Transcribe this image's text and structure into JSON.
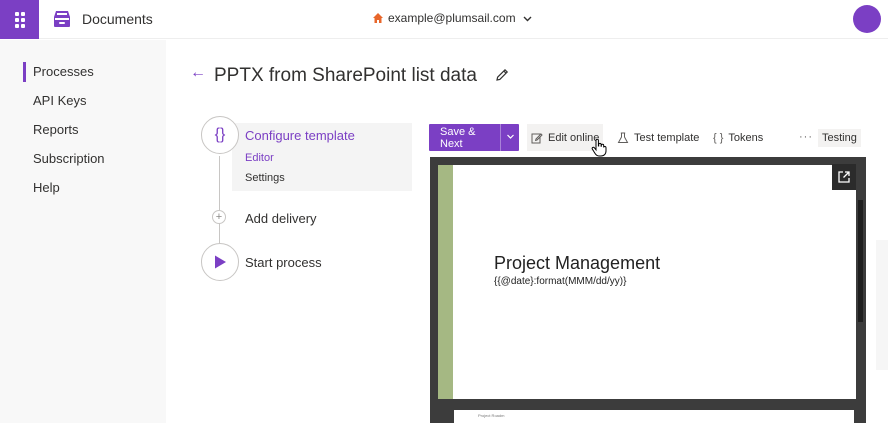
{
  "header": {
    "app_name": "Documents",
    "account_email": "example@plumsail.com"
  },
  "sidebar": {
    "items": [
      {
        "label": "Processes",
        "active": true
      },
      {
        "label": "API Keys"
      },
      {
        "label": "Reports"
      },
      {
        "label": "Subscription"
      },
      {
        "label": "Help"
      }
    ]
  },
  "page": {
    "title": "PPTX from SharePoint list data"
  },
  "steps": {
    "configure": {
      "label": "Configure template",
      "icon": "{}",
      "sub": [
        "Editor",
        "Settings"
      ]
    },
    "delivery": {
      "label": "Add delivery",
      "icon": "+"
    },
    "start": {
      "label": "Start process"
    }
  },
  "toolbar": {
    "save_next": "Save & Next",
    "edit_online": "Edit online",
    "test_template": "Test template",
    "tokens": "Tokens",
    "more": "···",
    "badge": "Testing"
  },
  "preview": {
    "slide_title": "Project Management",
    "slide_subtitle": "{{@date}:format(MMM/dd/yy)}",
    "next_slide_caption": "Project Roadm"
  },
  "colors": {
    "accent": "#7b3fc4",
    "home_icon": "#e8662a",
    "slide_accent": "#a5b883"
  }
}
